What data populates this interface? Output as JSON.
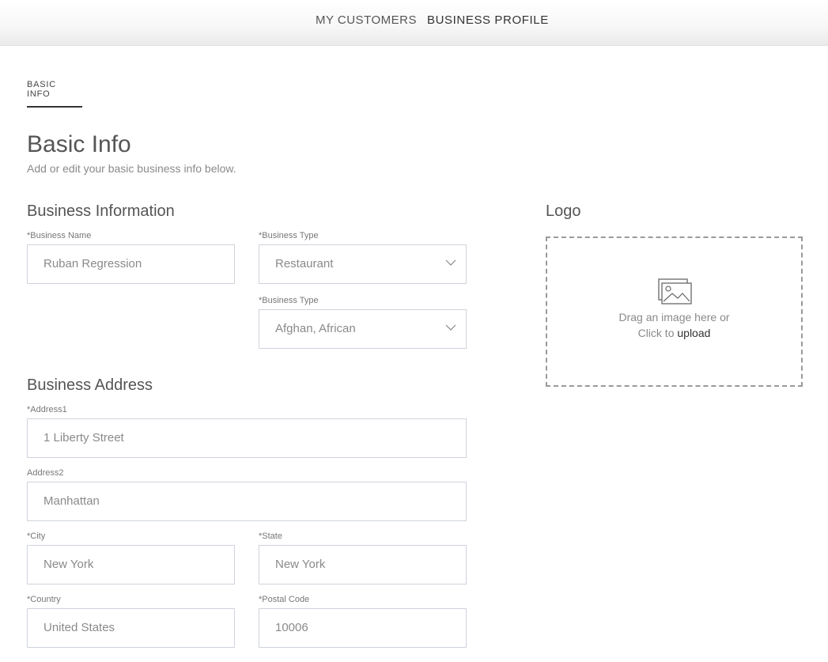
{
  "nav": {
    "my_customers": "MY CUSTOMERS",
    "business_profile": "BUSINESS PROFILE"
  },
  "subtab": "BASIC INFO",
  "header": {
    "title": "Basic Info",
    "subtitle": "Add or edit your basic business info below."
  },
  "business_info": {
    "title": "Business Information",
    "name_label": "*Business Name",
    "name_value": "Ruban Regression",
    "type_label": "*Business Type",
    "type_value": "Restaurant",
    "type2_label": "*Business Type",
    "type2_value": "Afghan, African"
  },
  "business_address": {
    "title": "Business Address",
    "address1_label": "*Address1",
    "address1_value": "1 Liberty Street",
    "address2_label": "Address2",
    "address2_value": "Manhattan",
    "city_label": "*City",
    "city_value": "New York",
    "state_label": "*State",
    "state_value": "New York",
    "country_label": "*Country",
    "country_value": "United States",
    "postal_label": "*Postal Code",
    "postal_value": "10006"
  },
  "logo": {
    "title": "Logo",
    "drag_text": "Drag an image here or",
    "click_text": "Click to",
    "upload_text": "upload"
  },
  "icons": {
    "dropdown": "chevron-down-icon",
    "image": "image-icon"
  }
}
